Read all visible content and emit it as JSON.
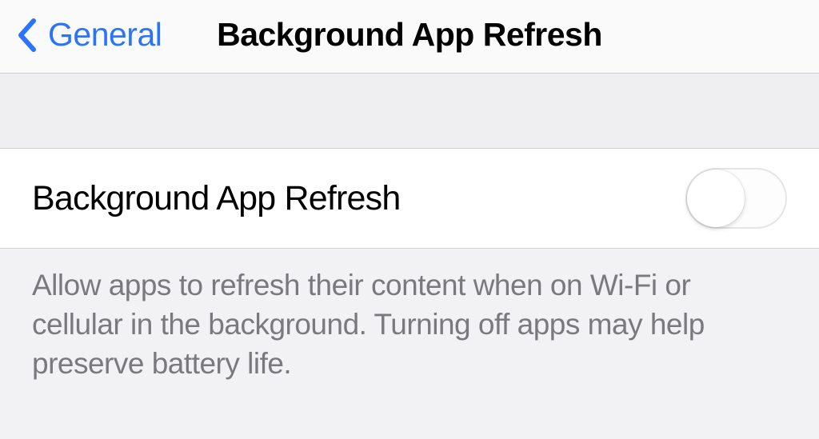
{
  "header": {
    "back_label": "General",
    "title": "Background App Refresh"
  },
  "main": {
    "row_label": "Background App Refresh",
    "toggle_state": "off"
  },
  "footer": {
    "description": "Allow apps to refresh their content when on Wi-Fi or cellular in the background. Turning off apps may help preserve battery life."
  },
  "colors": {
    "accent": "#2a74fa",
    "background": "#efeff1",
    "row_bg": "#ffffff",
    "text_secondary": "#7a7a7e"
  }
}
